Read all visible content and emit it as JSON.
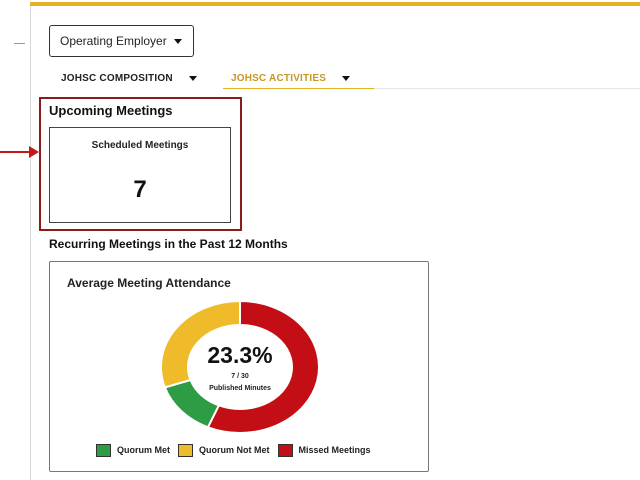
{
  "filters": {
    "employer_select_value": "Operating Employer"
  },
  "tabs": [
    {
      "label": "JOHSC COMPOSITION"
    },
    {
      "label": "JOHSC ACTIVITIES"
    }
  ],
  "upcoming": {
    "title": "Upcoming Meetings",
    "card_label": "Scheduled Meetings",
    "card_value": "7"
  },
  "recurring": {
    "title": "Recurring Meetings in the Past 12 Months"
  },
  "attendance": {
    "title": "Average Meeting Attendance",
    "center_value": "23.3%",
    "center_count": "7 / 30",
    "center_caption": "Published Minutes"
  },
  "colors": {
    "accent_gold": "#e3b224",
    "highlight_red": "#8b1a1a",
    "arrow_red": "#c0181b"
  },
  "icons": {
    "employer_dropdown": "chevron-down-icon",
    "tab_dropdown": "chevron-down-icon",
    "pointer": "arrow-right-icon"
  },
  "chart_data": {
    "type": "pie",
    "title": "Average Meeting Attendance",
    "categories": [
      "Quorum Met",
      "Quorum Not Met",
      "Missed Meetings"
    ],
    "values": [
      4,
      9,
      17
    ],
    "colors": [
      "#2e9b45",
      "#efbb2a",
      "#c20e14"
    ],
    "donut": true,
    "legend": "bottom"
  }
}
